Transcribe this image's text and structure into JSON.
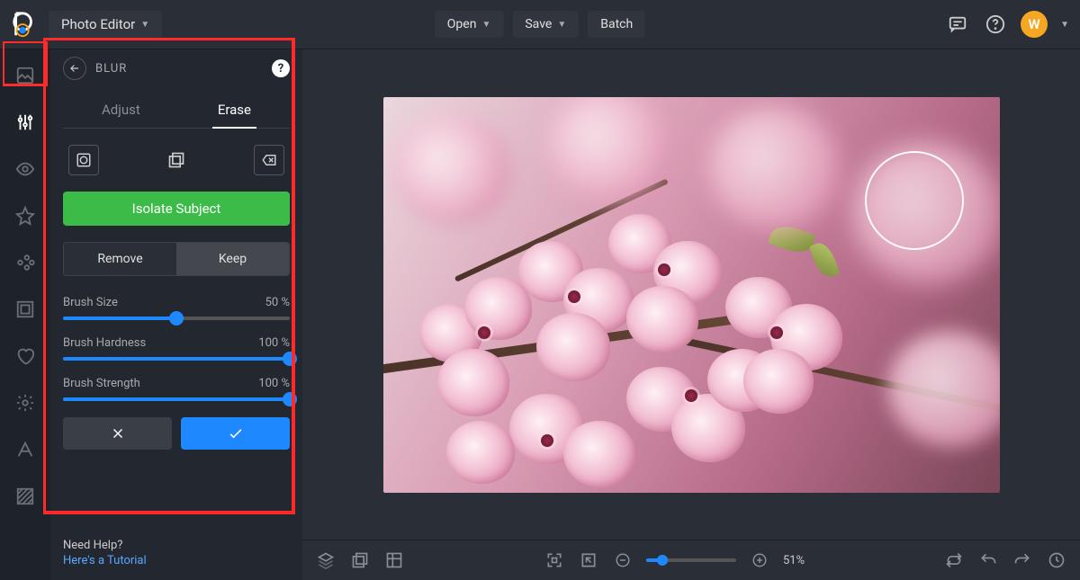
{
  "header": {
    "app_name": "Photo Editor",
    "open_label": "Open",
    "save_label": "Save",
    "batch_label": "Batch",
    "avatar_initial": "W"
  },
  "panel": {
    "title": "BLUR",
    "tabs": {
      "adjust": "Adjust",
      "erase": "Erase",
      "active": "erase"
    },
    "isolate_label": "Isolate Subject",
    "remove_label": "Remove",
    "keep_label": "Keep",
    "rk_active": "keep",
    "sliders": [
      {
        "label": "Brush Size",
        "value": 50,
        "unit": "%"
      },
      {
        "label": "Brush Hardness",
        "value": 100,
        "unit": "%"
      },
      {
        "label": "Brush Strength",
        "value": 100,
        "unit": "%"
      }
    ],
    "help_q": "Need Help?",
    "help_link": "Here's a Tutorial"
  },
  "bottom": {
    "zoom_pct": 51,
    "zoom_label": "51%"
  },
  "colors": {
    "accent": "#1e88ff",
    "green": "#3dbb49",
    "highlight": "#ff2a2a",
    "avatar": "#f5a623"
  }
}
